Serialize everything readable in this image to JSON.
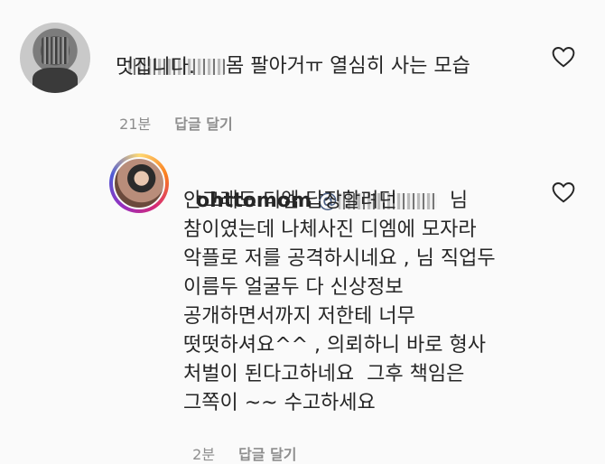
{
  "comments": [
    {
      "text_line1": "몸 팔아거ㅠ 열심히 사는 모습",
      "text_line2": "멋집니다.",
      "time": "21분",
      "reply_label": "답글 달기",
      "icons": {
        "avatar": "avatar-blurred",
        "like": "heart-outline-icon"
      }
    },
    {
      "username": "ohttomom",
      "mention_prefix": "@",
      "mention_suffix": "님",
      "lines": [
        "안그래도 디엠 답장할려던",
        "참이였는데 나체사진 디엠에 모자라",
        "악플로 저를 공격하시네요 , 님 직업두",
        "이름두 얼굴두 다 신상정보",
        "공개하면서까지 저한테 너무",
        "떳떳하셔요^^ , 의뢰하니 바로 형사",
        "처벌이 된다고하네요  그후 책임은",
        "그쪽이 ~~ 수고하세요"
      ],
      "time": "2분",
      "reply_label": "답글 달기",
      "icons": {
        "avatar": "avatar-story-ring",
        "like": "heart-outline-icon"
      }
    }
  ],
  "colors": {
    "background": "#fafafa",
    "text": "#262626",
    "meta": "#8e8e8e",
    "mention": "#4a5e82"
  }
}
